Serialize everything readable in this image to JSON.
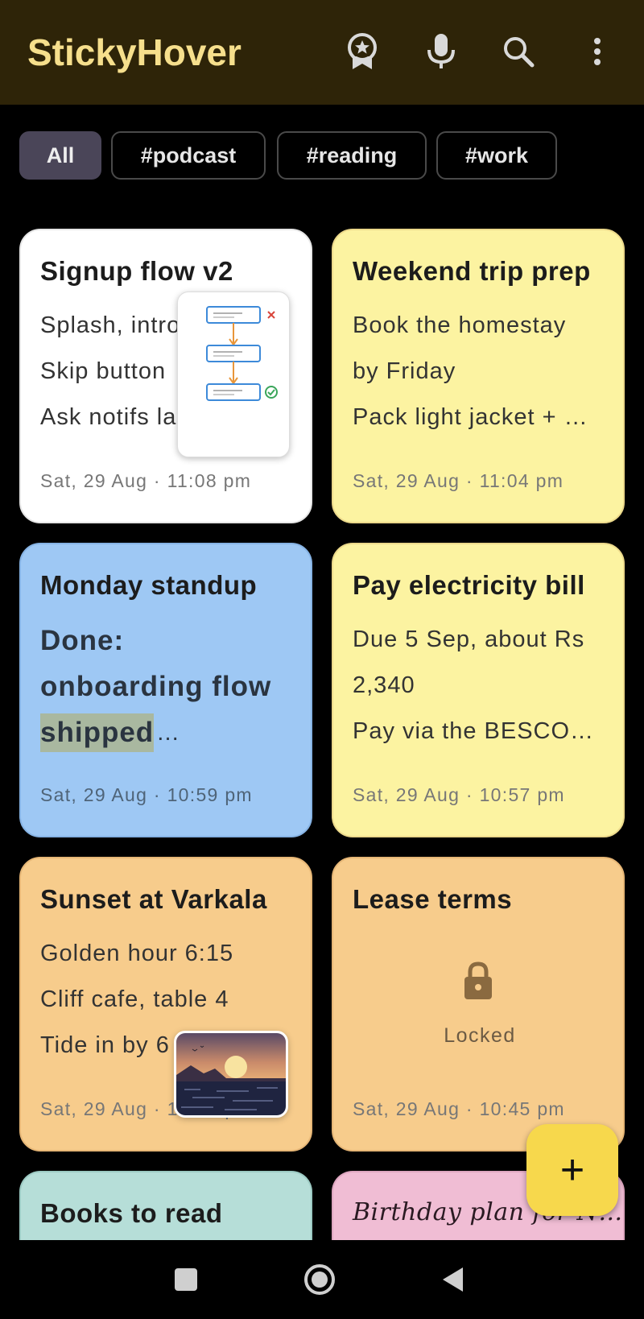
{
  "app": {
    "title": "StickyHover"
  },
  "toolbar": {
    "icons": [
      "badge-star-icon",
      "microphone-icon",
      "search-icon",
      "more-vert-icon"
    ]
  },
  "filters": [
    {
      "label": "All",
      "active": true
    },
    {
      "label": "#podcast",
      "active": false
    },
    {
      "label": "#reading",
      "active": false
    },
    {
      "label": "#work",
      "active": false
    }
  ],
  "notes": [
    {
      "title": "Signup flow v2",
      "lines": [
        "Splash, intro",
        "Skip button",
        "Ask notifs la"
      ],
      "date": "Sat, 29 Aug · 11:08 pm",
      "color": "#ffffff"
    },
    {
      "title": "Weekend trip prep",
      "lines": [
        "Book the homestay",
        "by Friday",
        "Pack light jacket + …"
      ],
      "date": "Sat, 29 Aug · 11:04 pm",
      "color": "#fcf3a1"
    },
    {
      "title": "Monday standup",
      "lines": [
        "Done:",
        "onboarding flow",
        "shipped",
        "…"
      ],
      "date": "Sat, 29 Aug · 10:59 pm",
      "color": "#9ec8f4"
    },
    {
      "title": "Pay electricity bill",
      "lines": [
        "Due 5 Sep, about Rs",
        "2,340",
        "Pay via the BESCO…"
      ],
      "date": "Sat, 29 Aug · 10:57 pm",
      "color": "#fcf3a1"
    },
    {
      "title": "Sunset at Varkala",
      "lines": [
        "Golden hour 6:15",
        "Cliff cafe, table 4",
        "Tide in by 6"
      ],
      "date": "Sat, 29 Aug · 10:54 pm",
      "color": "#f7cc8c"
    },
    {
      "title": "Lease terms",
      "locked_label": "Locked",
      "date": "Sat, 29 Aug · 10:45 pm",
      "color": "#f7cc8c"
    },
    {
      "title": "Books to read",
      "color": "#b6ded8"
    },
    {
      "title": "Birthday plan for N…",
      "color": "#f0bdd4"
    }
  ],
  "fab": {
    "label": "+"
  },
  "navigation": {
    "icons": [
      "recents-square-icon",
      "home-circle-icon",
      "back-triangle-icon"
    ]
  }
}
